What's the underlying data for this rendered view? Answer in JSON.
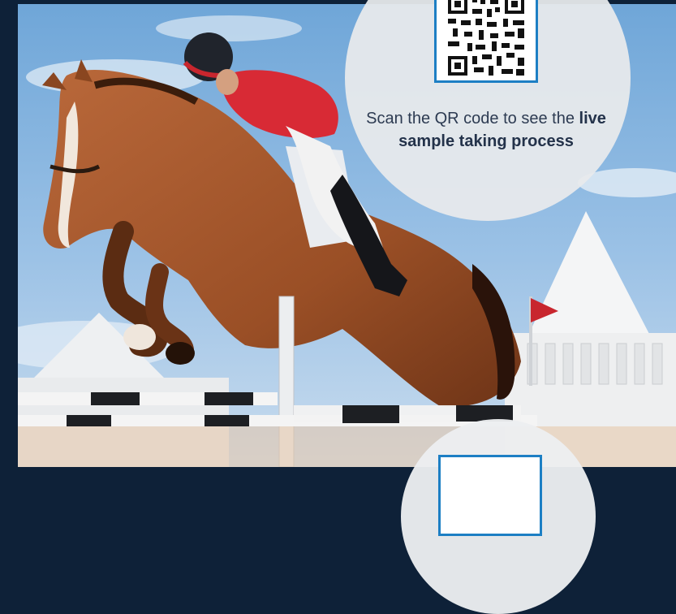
{
  "photo": {
    "description_icon": "show-jumping-horse-photo"
  },
  "qr_callout": {
    "icon": "qr-code-icon",
    "caption_lead": "Scan the QR code to see the",
    "caption_emphasis": "live sample taking process",
    "border_color": "#1d7fc4",
    "circle_color": "#e8eaec"
  },
  "bottom_callout": {
    "icon": "qr-code-icon",
    "border_color": "#1d7fc4"
  },
  "colors": {
    "frame": "#0e2138",
    "caption_text": "#23324a"
  }
}
